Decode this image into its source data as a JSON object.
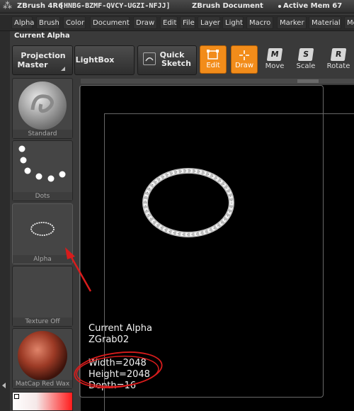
{
  "titlebar": {
    "app": "ZBrush 4R6",
    "serial": "[HNBG-BZMF-QVCY-UGZI-NFJJ]",
    "document": "ZBrush Document",
    "memory": "Active Mem 67"
  },
  "menu": [
    "Alpha",
    "Brush",
    "Color",
    "Document",
    "Draw",
    "Edit",
    "File",
    "Layer",
    "Light",
    "Macro",
    "Marker",
    "Material",
    "Me"
  ],
  "palette_title": "Current Alpha",
  "toolbar": {
    "projection_master": [
      "Projection",
      "Master"
    ],
    "lightbox": "LightBox",
    "quick_sketch": [
      "Quick",
      "Sketch"
    ],
    "edit": "Edit",
    "draw": "Draw",
    "move": "Move",
    "move_key": "M",
    "scale": "Scale",
    "scale_key": "S",
    "rotate": "Rotate",
    "rotate_key": "R"
  },
  "thumbs": {
    "brush": "Standard",
    "stroke": "Dots",
    "alpha": "Alpha",
    "texture": "Texture Off",
    "material": "MatCap Red Wax"
  },
  "info": {
    "heading": "Current Alpha",
    "name": "ZGrab02",
    "width": "Width=2048",
    "height": "Height=2048",
    "depth": "Depth=16"
  },
  "colors": {
    "accent": "#f28c1a",
    "annotation": "#d81c1c",
    "background": "#3a3a3a",
    "canvas": "#000000"
  }
}
